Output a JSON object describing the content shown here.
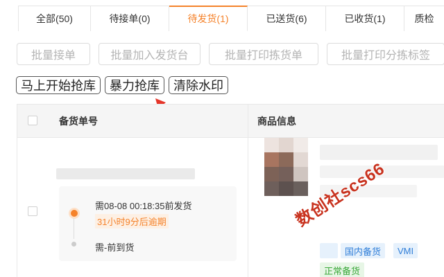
{
  "tabs": [
    {
      "label": "全部(50)"
    },
    {
      "label": "待接单(0)"
    },
    {
      "label": "待发货(1)"
    },
    {
      "label": "已送货(6)"
    },
    {
      "label": "已收货(1)"
    },
    {
      "label": "质检"
    }
  ],
  "batch_buttons": [
    {
      "label": "批量接单"
    },
    {
      "label": "批量加入发货台"
    },
    {
      "label": "批量打印拣货单"
    },
    {
      "label": "批量打印分拣标签"
    }
  ],
  "action_buttons": [
    {
      "label": "马上开始抢库"
    },
    {
      "label": "暴力抢库"
    },
    {
      "label": "清除水印"
    }
  ],
  "table": {
    "headers": {
      "order_no": "备货单号",
      "product_info": "商品信息"
    },
    "row": {
      "ship_deadline": "需08-08 00:18:35前发货",
      "overdue": "31小时9分后逾期",
      "arrive": "需-前到货",
      "tags": [
        "国内备货",
        "VMI",
        "正常备货"
      ]
    }
  },
  "watermark_text": "数创社scs66",
  "colors": {
    "accent": "#f5822a",
    "tag_blue": "#2f7ed8",
    "tag_green": "#3aa83a",
    "watermark": "#c8321e"
  }
}
